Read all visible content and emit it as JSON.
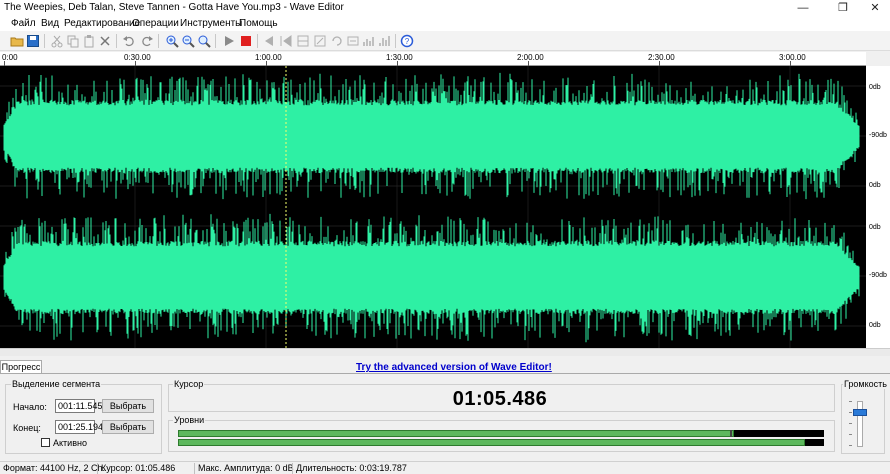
{
  "window": {
    "title": "The Weepies, Deb Talan, Steve Tannen - Gotta Have You.mp3 - Wave Editor",
    "minimize_glyph": "—",
    "maximize_glyph": "❐",
    "close_glyph": "✕"
  },
  "menu": [
    "Файл",
    "Вид",
    "Редактирование",
    "Операции",
    "Инструменты",
    "Помощь"
  ],
  "toolbar": {
    "icons": [
      "open-folder-icon",
      "save-icon",
      "cut-icon",
      "copy-icon",
      "paste-icon",
      "delete-icon",
      "undo-icon",
      "redo-icon",
      "zoom-in-icon",
      "zoom-out-icon",
      "zoom-fit-icon",
      "play-icon",
      "record-icon",
      "fade-in-icon",
      "fade-out-icon",
      "normalize-icon",
      "amplify-icon",
      "silence-icon",
      "reverse-icon",
      "invert-icon",
      "spectrum-icon",
      "effects-icon",
      "help-icon"
    ],
    "colors": {
      "record": "#e02020",
      "help": "#2a5bd8",
      "folder": "#e8b84a",
      "save": "#2a6fc9"
    }
  },
  "ruler": {
    "labels": [
      "0:00",
      "0:30.00",
      "1:00.00",
      "1:30.00",
      "2:00.00",
      "2:30.00",
      "3:00.00"
    ]
  },
  "waveform": {
    "color": "#2ef0a4",
    "background": "#000000",
    "channels": 2,
    "selection_color": "#f3ff6b",
    "cursor_color": "#f3ff6b"
  },
  "db_scale": {
    "channel1": [
      "0db",
      "-90db",
      "0db"
    ],
    "channel2": [
      "0db",
      "-90db",
      "0db"
    ]
  },
  "tab": {
    "label": "Прогресс"
  },
  "promo": {
    "text": "Try the advanced version of Wave Editor!"
  },
  "segment": {
    "title": "Выделение сегмента",
    "start_label": "Начало:",
    "start_value": "001:11.545",
    "end_label": "Конец:",
    "end_value": "001:25.194",
    "select_button": "Выбрать",
    "active_label": "Активно",
    "active_checked": false
  },
  "cursor_panel": {
    "title": "Курсор",
    "time": "01:05.486"
  },
  "levels_panel": {
    "title": "Уровни",
    "left_level": 0.86,
    "right_level": 0.97
  },
  "volume": {
    "title": "Громкость",
    "level": 0.8
  },
  "status": {
    "format": "Формат: 44100 Hz, 2 Ch.",
    "cursor": "Курсор: 01:05.486",
    "max_amplitude": "Макс. Амплитуда: 0 dB",
    "duration": "Длительность: 0:03:19.787"
  }
}
